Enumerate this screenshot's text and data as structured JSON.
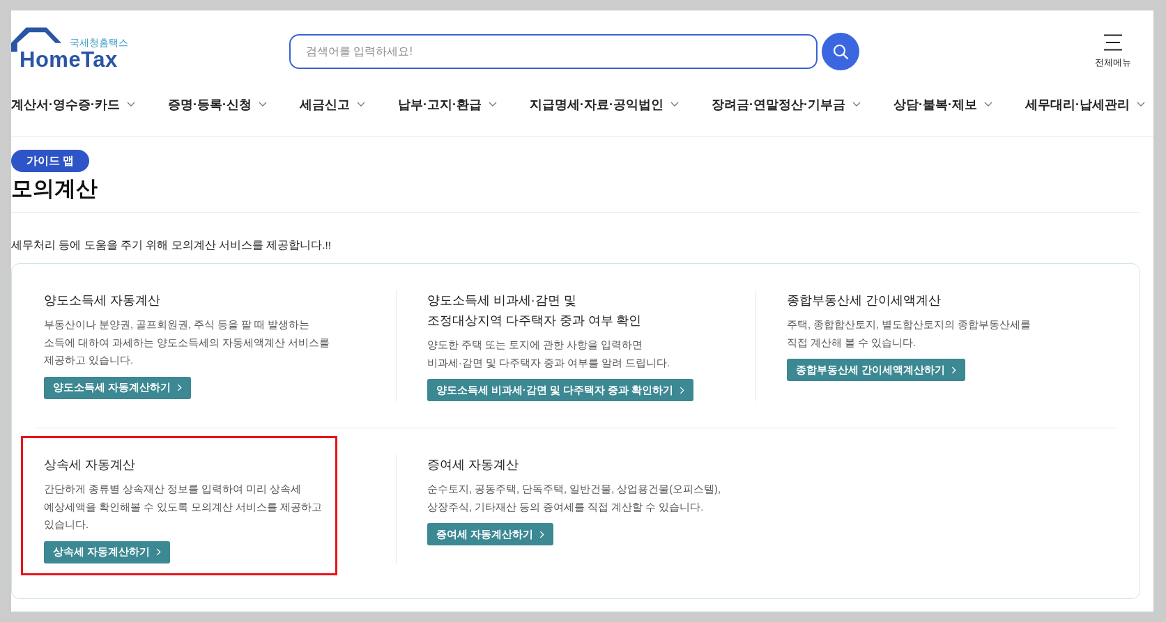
{
  "logo": {
    "caption": "국세청홈택스",
    "wordmark": "HomeTax"
  },
  "search": {
    "placeholder": "검색어를 입력하세요!"
  },
  "menu_button": {
    "label": "전체메뉴"
  },
  "nav": [
    {
      "label": "계산서·영수증·카드"
    },
    {
      "label": "증명·등록·신청"
    },
    {
      "label": "세금신고"
    },
    {
      "label": "납부·고지·환급"
    },
    {
      "label": "지급명세·자료·공익법인"
    },
    {
      "label": "장려금·연말정산·기부금"
    },
    {
      "label": "상담·불복·제보"
    },
    {
      "label": "세무대리·납세관리"
    }
  ],
  "badge": "가이드 맵",
  "title": "모의계산",
  "intro": "세무처리 등에 도움을 주기 위해 모의계산 서비스를 제공합니다.!!",
  "service_rows": [
    {
      "items": [
        {
          "title_lines": [
            "양도소득세 자동계산"
          ],
          "description_lines": [
            "부동산이나 분양권, 골프회원권, 주식 등을 팔 때 발생하는",
            "소득에 대하여 과세하는 양도소득세의 자동세액계산 서비스를",
            "제공하고 있습니다."
          ],
          "button": "양도소득세 자동계산하기",
          "highlighted": false
        },
        {
          "title_lines": [
            "양도소득세 비과세·감면 및",
            "조정대상지역 다주택자 중과 여부 확인"
          ],
          "description_lines": [
            "양도한 주택 또는 토지에 관한 사항을 입력하면",
            "비과세·감면 및 다주택자 중과 여부를 알려 드립니다."
          ],
          "button": "양도소득세 비과세·감면 및 다주택자 중과 확인하기",
          "highlighted": false
        },
        {
          "title_lines": [
            "종합부동산세 간이세액계산"
          ],
          "description_lines": [
            "주택, 종합합산토지, 별도합산토지의 종합부동산세를",
            "직접 계산해 볼 수 있습니다."
          ],
          "button": "종합부동산세 간이세액계산하기",
          "highlighted": false
        }
      ]
    },
    {
      "items": [
        {
          "title_lines": [
            "상속세 자동계산"
          ],
          "description_lines": [
            "간단하게 종류별 상속재산 정보를 입력하여 미리 상속세",
            "예상세액을 확인해볼 수 있도록 모의계산 서비스를 제공하고",
            "있습니다."
          ],
          "button": "상속세 자동계산하기",
          "highlighted": true
        },
        {
          "title_lines": [
            "증여세 자동계산"
          ],
          "description_lines": [
            "순수토지, 공동주택, 단독주택, 일반건물, 상업용건물(오피스텔),",
            "상장주식, 기타재산 등의 증여세를 직접 계산할 수 있습니다."
          ],
          "button": "증여세 자동계산하기",
          "highlighted": false
        }
      ]
    }
  ]
}
